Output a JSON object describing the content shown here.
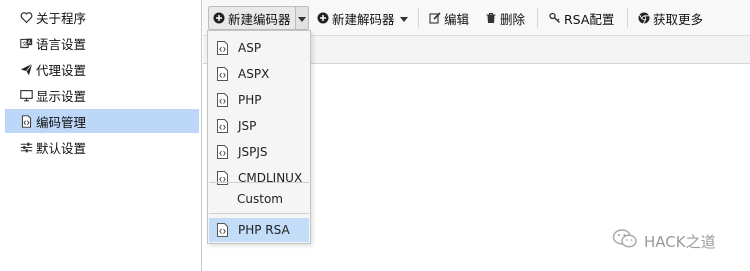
{
  "sidebar": {
    "items": [
      {
        "label": "关于程序",
        "icon": "heart-icon"
      },
      {
        "label": "语言设置",
        "icon": "language-icon"
      },
      {
        "label": "代理设置",
        "icon": "paper-plane-icon"
      },
      {
        "label": "显示设置",
        "icon": "monitor-icon"
      },
      {
        "label": "编码管理",
        "icon": "file-code-icon",
        "selected": true
      },
      {
        "label": "默认设置",
        "icon": "sliders-icon"
      }
    ]
  },
  "toolbar": {
    "new_encoder": "新建编码器",
    "new_decoder": "新建解码器",
    "edit": "编辑",
    "delete": "删除",
    "rsa": "RSA配置",
    "get_more": "获取更多"
  },
  "dropdown": {
    "items": [
      {
        "label": "ASP"
      },
      {
        "label": "ASPX"
      },
      {
        "label": "PHP"
      },
      {
        "label": "JSP"
      },
      {
        "label": "JSPJS"
      },
      {
        "label": "CMDLINUX"
      },
      {
        "label": "Custom"
      },
      {
        "label": "PHP RSA",
        "active": true
      }
    ]
  },
  "watermark": {
    "text": "HACK之道"
  },
  "colors": {
    "selection": "#bcd7f8",
    "dropdown_active": "#c3dcf7",
    "toolbar_bg": "#f8f8f8"
  }
}
